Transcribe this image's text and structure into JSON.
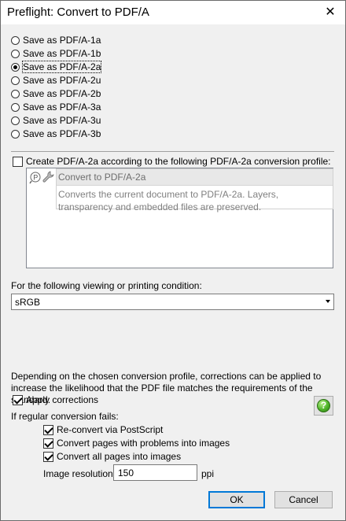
{
  "window": {
    "title": "Preflight: Convert to PDF/A",
    "close_glyph": "✕"
  },
  "pdfa_options": [
    {
      "label": "Save as PDF/A-1a",
      "checked": false
    },
    {
      "label": "Save as PDF/A-1b",
      "checked": false
    },
    {
      "label": "Save as PDF/A-2a",
      "checked": true
    },
    {
      "label": "Save as PDF/A-2u",
      "checked": false
    },
    {
      "label": "Save as PDF/A-2b",
      "checked": false
    },
    {
      "label": "Save as PDF/A-3a",
      "checked": false
    },
    {
      "label": "Save as PDF/A-3u",
      "checked": false
    },
    {
      "label": "Save as PDF/A-3b",
      "checked": false
    }
  ],
  "create_profile": {
    "label": "Create PDF/A-2a according to the following PDF/A-2a conversion profile:",
    "checked": false
  },
  "profile": {
    "name": "Convert to PDF/A-2a",
    "description": "Converts the current document to PDF/A-2a. Layers, transparency and embedded files are preserved.",
    "icons": [
      "preflight-p-icon",
      "wrench-icon"
    ]
  },
  "condition": {
    "label": "For the following viewing or printing condition:",
    "value": "sRGB"
  },
  "corrections": {
    "description": "Depending on the chosen conversion profile, corrections can be applied to increase the likelihood that the PDF file matches the requirements of the standard:",
    "apply_label": "Apply corrections",
    "apply_checked": true,
    "help_glyph": "?"
  },
  "fallback": {
    "label": "If regular conversion fails:",
    "options": [
      {
        "label": "Re-convert via PostScript",
        "checked": true
      },
      {
        "label": "Convert pages with problems into images",
        "checked": true
      },
      {
        "label": "Convert all pages into images",
        "checked": true
      }
    ],
    "resolution_label": "Image resolution:",
    "resolution_value": "150",
    "resolution_unit": "ppi"
  },
  "buttons": {
    "ok": "OK",
    "cancel": "Cancel"
  },
  "colors": {
    "focus_border": "#0078d7",
    "help_green": "#4fb52a"
  }
}
